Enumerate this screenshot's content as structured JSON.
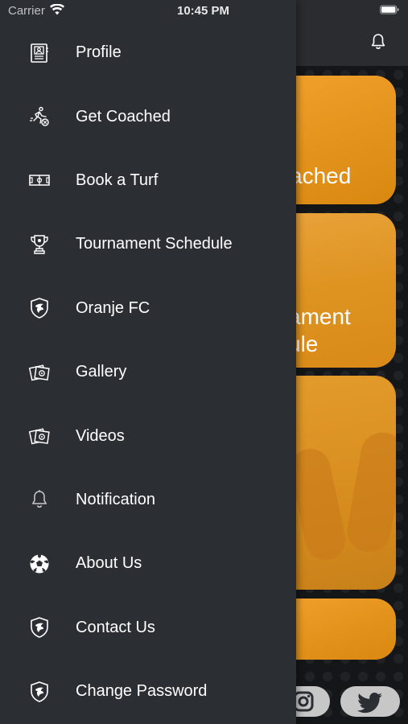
{
  "status_bar": {
    "carrier": "Carrier",
    "time": "10:45 PM"
  },
  "background": {
    "card_1_text": "ached",
    "card_2_text_line1": "ament",
    "card_2_text_line2": "ule"
  },
  "drawer": {
    "items": [
      {
        "label": "Profile",
        "icon": "profile-card-icon"
      },
      {
        "label": "Get Coached",
        "icon": "coach-player-icon"
      },
      {
        "label": "Book a Turf",
        "icon": "turf-field-icon"
      },
      {
        "label": "Tournament Schedule",
        "icon": "trophy-icon"
      },
      {
        "label": "Oranje FC",
        "icon": "club-shield-icon"
      },
      {
        "label": "Gallery",
        "icon": "photos-icon"
      },
      {
        "label": "Videos",
        "icon": "photos-icon"
      },
      {
        "label": "Notification",
        "icon": "bell-icon"
      },
      {
        "label": "About Us",
        "icon": "soccer-ball-icon"
      },
      {
        "label": "Contact Us",
        "icon": "club-shield-icon"
      },
      {
        "label": "Change Password",
        "icon": "club-shield-icon"
      }
    ]
  },
  "colors": {
    "drawer_bg": "#2b2e33",
    "accent_orange": "#e3921c",
    "text": "#ffffff"
  }
}
